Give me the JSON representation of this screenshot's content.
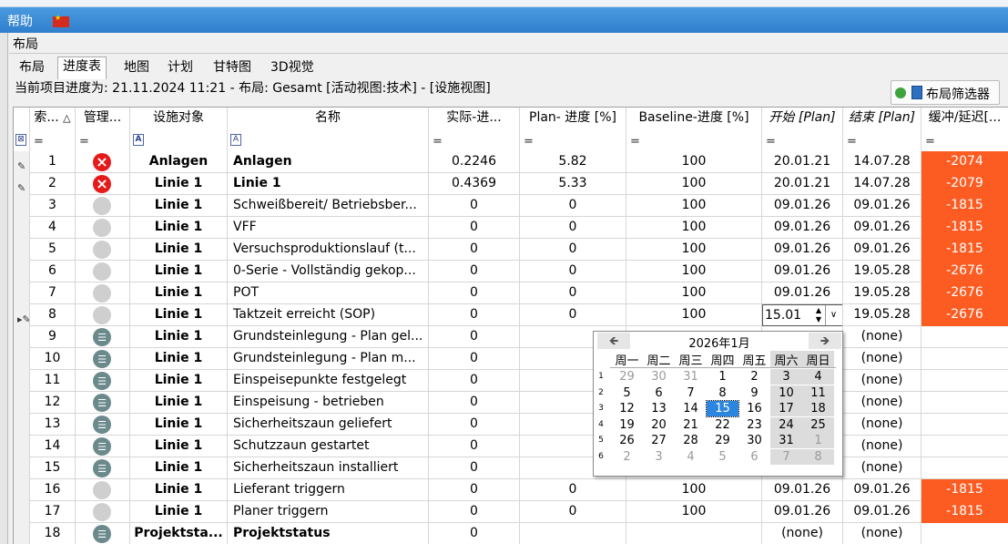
{
  "menu": {
    "help": "帮助"
  },
  "panel": {
    "title": "布局"
  },
  "tabs": [
    "布局",
    "进度表",
    "地图",
    "计划",
    "甘特图",
    "3D视觉"
  ],
  "status_line": "当前项目进度为: 21.11.2024 11:21 - 布局: Gesamt [活动视图:技术] - [设施视图]",
  "filter_button": "布局筛选器",
  "columns": [
    "索...",
    "管理...",
    "设施对象",
    "名称",
    "实际-进...",
    "Plan- 进度 [%]",
    "Baseline-进度 [%]",
    "开始 [Plan]",
    "结束 [Plan]",
    "缓冲/延迟[..."
  ],
  "filter_eq": "=",
  "rows": [
    {
      "idx": "1",
      "status": "red",
      "obj": "Anlagen",
      "name": "Anlagen",
      "name_bold": true,
      "actual": "0.2246",
      "plan": "5.82",
      "base": "100",
      "start": "20.01.21",
      "end": "14.07.28",
      "buffer": "-2074",
      "mark": "pencil"
    },
    {
      "idx": "2",
      "status": "red",
      "obj": "Linie 1",
      "name": "Linie 1",
      "name_bold": true,
      "actual": "0.4369",
      "plan": "5.33",
      "base": "100",
      "start": "20.01.21",
      "end": "14.07.28",
      "buffer": "-2079",
      "mark": "pencil"
    },
    {
      "idx": "3",
      "status": "grey",
      "obj": "Linie 1",
      "name": "Schweißbereit/ Betriebsber...",
      "actual": "0",
      "plan": "0",
      "base": "100",
      "start": "09.01.26",
      "end": "09.01.26",
      "buffer": "-1815"
    },
    {
      "idx": "4",
      "status": "grey",
      "obj": "Linie 1",
      "name": "VFF",
      "actual": "0",
      "plan": "0",
      "base": "100",
      "start": "09.01.26",
      "end": "09.01.26",
      "buffer": "-1815"
    },
    {
      "idx": "5",
      "status": "grey",
      "obj": "Linie 1",
      "name": "Versuchsproduktionslauf (t...",
      "actual": "0",
      "plan": "0",
      "base": "100",
      "start": "09.01.26",
      "end": "09.01.26",
      "buffer": "-1815"
    },
    {
      "idx": "6",
      "status": "grey",
      "obj": "Linie 1",
      "name": "0-Serie - Vollständig gekop...",
      "actual": "0",
      "plan": "0",
      "base": "100",
      "start": "09.01.26",
      "end": "19.05.28",
      "buffer": "-2676"
    },
    {
      "idx": "7",
      "status": "grey",
      "obj": "Linie 1",
      "name": "POT",
      "actual": "0",
      "plan": "0",
      "base": "100",
      "start": "09.01.26",
      "end": "19.05.28",
      "buffer": "-2676"
    },
    {
      "idx": "8",
      "status": "grey",
      "obj": "Linie 1",
      "name": "Taktzeit erreicht (SOP)",
      "actual": "0",
      "plan": "0",
      "base": "100",
      "start": "15.01",
      "end": "19.05.28",
      "buffer": "-2676",
      "mark": "edit",
      "editing": true
    },
    {
      "idx": "9",
      "status": "list",
      "obj": "Linie 1",
      "name": "Grundsteinlegung - Plan gel...",
      "actual": "0",
      "plan": "",
      "base": "",
      "start": "",
      "end": "(none)",
      "buffer": ""
    },
    {
      "idx": "10",
      "status": "list",
      "obj": "Linie 1",
      "name": "Grundsteinlegung - Plan m...",
      "actual": "0",
      "plan": "",
      "base": "",
      "start": "",
      "end": "(none)",
      "buffer": ""
    },
    {
      "idx": "11",
      "status": "list",
      "obj": "Linie 1",
      "name": "Einspeisepunkte festgelegt",
      "actual": "0",
      "plan": "",
      "base": "",
      "start": "",
      "end": "(none)",
      "buffer": ""
    },
    {
      "idx": "12",
      "status": "list",
      "obj": "Linie 1",
      "name": "Einspeisung - betrieben",
      "actual": "0",
      "plan": "",
      "base": "",
      "start": "",
      "end": "(none)",
      "buffer": ""
    },
    {
      "idx": "13",
      "status": "list",
      "obj": "Linie 1",
      "name": "Sicherheitszaun geliefert",
      "actual": "0",
      "plan": "",
      "base": "",
      "start": "",
      "end": "(none)",
      "buffer": ""
    },
    {
      "idx": "14",
      "status": "list",
      "obj": "Linie 1",
      "name": "Schutzzaun gestartet",
      "actual": "0",
      "plan": "",
      "base": "",
      "start": "",
      "end": "(none)",
      "buffer": ""
    },
    {
      "idx": "15",
      "status": "list",
      "obj": "Linie 1",
      "name": "Sicherheitszaun installiert",
      "actual": "0",
      "plan": "",
      "base": "",
      "start": "",
      "end": "(none)",
      "buffer": ""
    },
    {
      "idx": "16",
      "status": "grey",
      "obj": "Linie 1",
      "name": "Lieferant triggern",
      "actual": "0",
      "plan": "0",
      "base": "100",
      "start": "09.01.26",
      "end": "09.01.26",
      "buffer": "-1815"
    },
    {
      "idx": "17",
      "status": "grey",
      "obj": "Linie 1",
      "name": "Planer triggern",
      "actual": "0",
      "plan": "0",
      "base": "100",
      "start": "09.01.26",
      "end": "09.01.26",
      "buffer": "-1815"
    },
    {
      "idx": "18",
      "status": "list",
      "obj": "Projektsta...",
      "name": "Projektstatus",
      "name_bold": true,
      "actual": "0",
      "plan": "",
      "base": "",
      "start": "(none)",
      "end": "(none)",
      "buffer": ""
    }
  ],
  "calendar": {
    "title": "2026年1月",
    "prev": "🡸",
    "next": "🡺",
    "weekdays": [
      "周一",
      "周二",
      "周三",
      "周四",
      "周五",
      "周六",
      "周日"
    ],
    "weeks": [
      {
        "no": "1",
        "days": [
          [
            "29",
            1
          ],
          [
            "30",
            1
          ],
          [
            "31",
            1
          ],
          [
            "1",
            0
          ],
          [
            "2",
            0
          ],
          [
            "3",
            0
          ],
          [
            "4",
            0
          ]
        ]
      },
      {
        "no": "2",
        "days": [
          [
            "5",
            0
          ],
          [
            "6",
            0
          ],
          [
            "7",
            0
          ],
          [
            "8",
            0
          ],
          [
            "9",
            0
          ],
          [
            "10",
            0
          ],
          [
            "11",
            0
          ]
        ]
      },
      {
        "no": "3",
        "days": [
          [
            "12",
            0
          ],
          [
            "13",
            0
          ],
          [
            "14",
            0
          ],
          [
            "15",
            0
          ],
          [
            "16",
            0
          ],
          [
            "17",
            0
          ],
          [
            "18",
            0
          ]
        ]
      },
      {
        "no": "4",
        "days": [
          [
            "19",
            0
          ],
          [
            "20",
            0
          ],
          [
            "21",
            0
          ],
          [
            "22",
            0
          ],
          [
            "23",
            0
          ],
          [
            "24",
            0
          ],
          [
            "25",
            0
          ]
        ]
      },
      {
        "no": "5",
        "days": [
          [
            "26",
            0
          ],
          [
            "27",
            0
          ],
          [
            "28",
            0
          ],
          [
            "29",
            0
          ],
          [
            "30",
            0
          ],
          [
            "31",
            0
          ],
          [
            "1",
            1
          ]
        ]
      },
      {
        "no": "6",
        "days": [
          [
            "2",
            1
          ],
          [
            "3",
            1
          ],
          [
            "4",
            1
          ],
          [
            "5",
            1
          ],
          [
            "6",
            1
          ],
          [
            "7",
            1
          ],
          [
            "8",
            1
          ]
        ]
      }
    ],
    "selected": "15"
  },
  "colors": {
    "buffer_red": "#fc5c22",
    "status_red": "#e51b1b",
    "accent": "#2c86e0"
  }
}
